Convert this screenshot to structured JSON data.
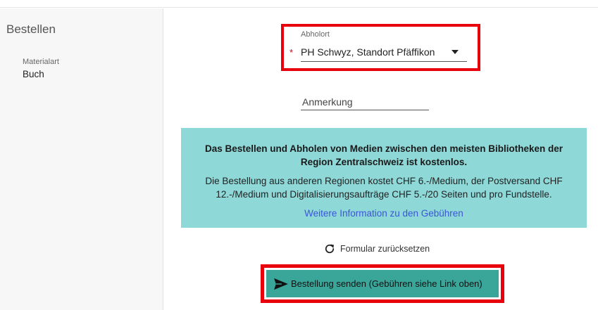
{
  "sidebar": {
    "title": "Bestellen",
    "material_label": "Materialart",
    "material_value": "Buch"
  },
  "form": {
    "pickup": {
      "label": "Abholort",
      "required_marker": "*",
      "value": "PH Schwyz, Standort Pfäffikon"
    },
    "remark": {
      "label": "Anmerkung"
    },
    "info": {
      "bold": "Das Bestellen und Abholen von Medien zwischen den meisten Bibliotheken der Region Zentralschweiz ist kostenlos.",
      "text": "Die Bestellung aus anderen Regionen kostet CHF 6.-/Medium, der Postversand CHF 12.-/Medium und Digitalisierungsaufträge CHF 5.-/20 Seiten und pro Fundstelle.",
      "link": "Weitere Information zu den Gebühren"
    },
    "reset_label": "Formular zurücksetzen",
    "submit_label": "Bestellung senden (Gebühren siehe Link oben)"
  },
  "colors": {
    "highlight": "#e8000d",
    "info_bg": "#8ed8d8",
    "submit_bg": "#3aa69a",
    "link": "#3a55d8"
  },
  "icons": {
    "reset": "refresh-icon",
    "submit": "send-icon",
    "dropdown": "caret-down-icon"
  }
}
